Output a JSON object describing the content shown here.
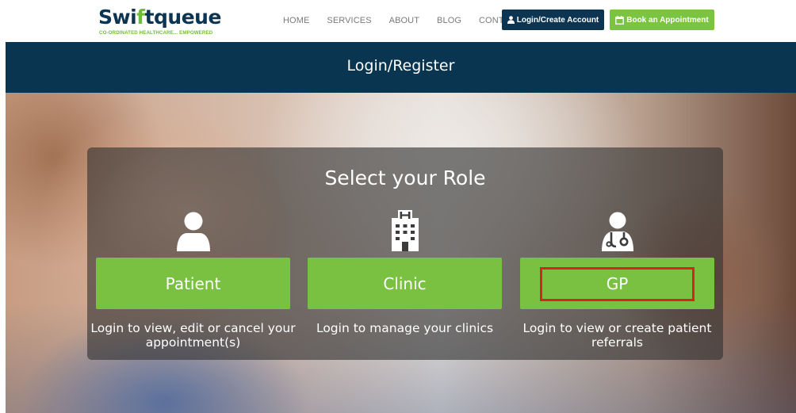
{
  "brand": {
    "name_part1": "Swi",
    "name_accent": "f",
    "name_part2": "tqueue",
    "tagline": "CO-ORDINATED HEALTHCARE... EMPOWERED"
  },
  "nav": {
    "items": [
      "HOME",
      "SERVICES",
      "ABOUT",
      "BLOG",
      "CONTACT"
    ]
  },
  "header_buttons": {
    "login": "Login/Create Account",
    "book": "Book an Appointment"
  },
  "banner": {
    "title": "Login/Register"
  },
  "panel": {
    "title": "Select your Role",
    "roles": [
      {
        "label": "Patient",
        "description": "Login to view, edit or cancel your appointment(s)",
        "icon": "user-icon"
      },
      {
        "label": "Clinic",
        "description": "Login to manage your clinics",
        "icon": "hospital-icon"
      },
      {
        "label": "GP",
        "description": "Login to view or create patient referrals",
        "icon": "doctor-icon"
      }
    ]
  },
  "colors": {
    "navy": "#0d3551",
    "green": "#7ac142",
    "highlight": "#d9241c"
  }
}
